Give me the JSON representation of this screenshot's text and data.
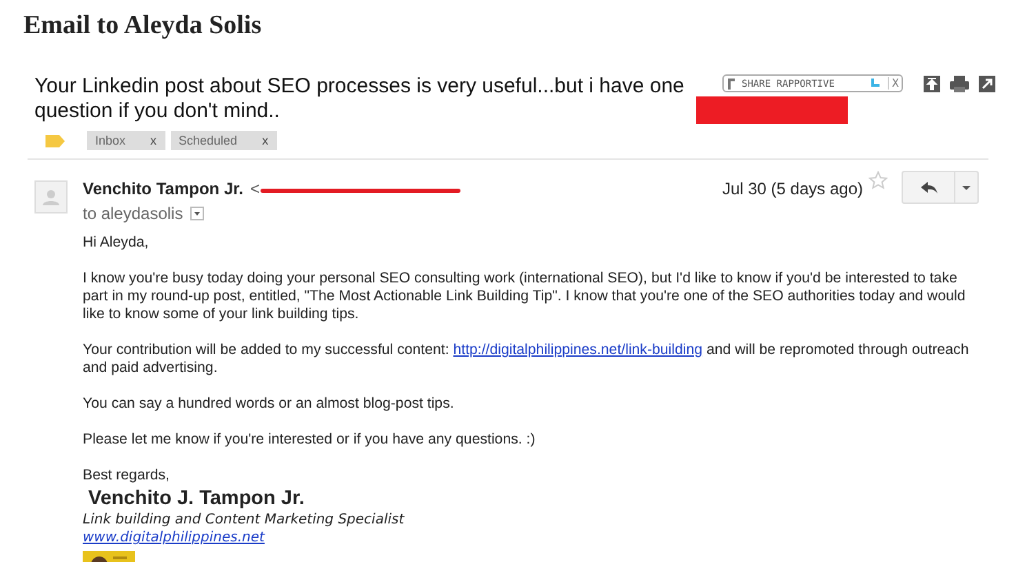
{
  "page_title": "Email to Aleyda Solis",
  "subject": "Your Linkedin post about SEO processes is very useful...but i have one question if you don't mind..",
  "share_widget": {
    "label": "SHARE RAPPORTIVE",
    "close": "X"
  },
  "labels": [
    {
      "name": "Inbox",
      "remove": "x"
    },
    {
      "name": "Scheduled",
      "remove": "x"
    }
  ],
  "message": {
    "sender": "Venchito Tampon Jr.",
    "sender_email_open": "<",
    "date": "Jul 30 (5 days ago)",
    "starred": false,
    "recipient": "to aleydasolis",
    "greeting": "Hi Aleyda,",
    "paragraphs": [
      {
        "kind": "text",
        "text": "I know you're busy today doing your personal SEO consulting work (international SEO), but I'd like to know if you'd be interested to take part in my round-up post, entitled, \"The Most Actionable Link Building Tip\". I know that you're one of the SEO authorities today and would like to know some of your link building tips."
      },
      {
        "kind": "link",
        "before": "Your contribution will be added to my successful content: ",
        "link": "http://digitalphilippines.net/link-building",
        "after": " and will be repromoted through outreach and paid advertising."
      },
      {
        "kind": "text",
        "text": "You can say a hundred words or an almost blog-post tips."
      },
      {
        "kind": "text",
        "text": "Please let me know if you're interested or if you have any questions. :)"
      }
    ],
    "closing": "Best regards,",
    "signature": {
      "name": "Venchito J. Tampon Jr.",
      "role": "Link building and Content Marketing Specialist",
      "website": "www.digitalphilippines.net",
      "kind": "picture"
    }
  }
}
